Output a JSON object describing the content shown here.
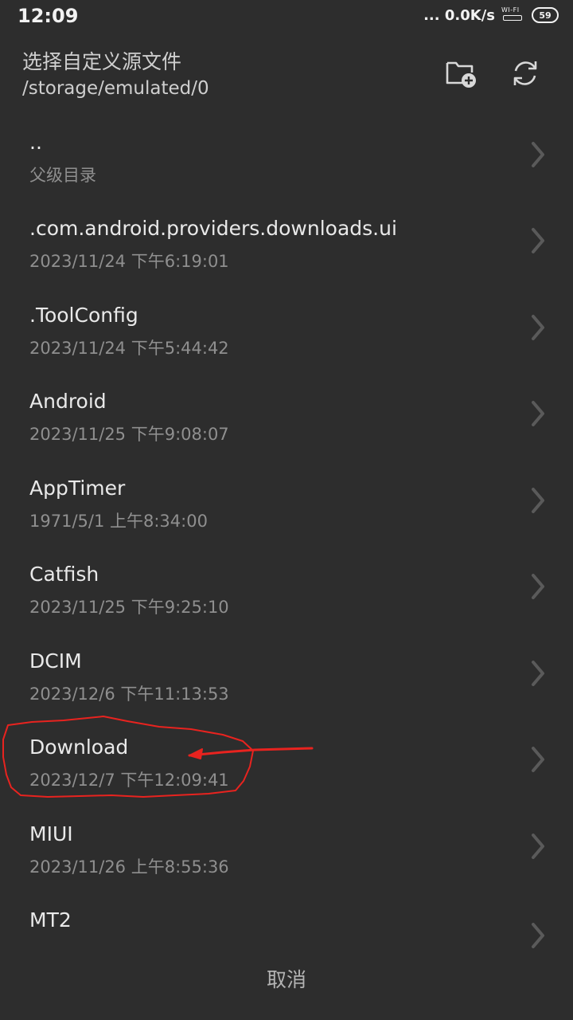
{
  "status_bar": {
    "time": "12:09",
    "speed": "... 0.0K/s",
    "wifi_label": "WI-FI",
    "battery_level": "59"
  },
  "header": {
    "title": "选择自定义源文件",
    "path": "/storage/emulated/0",
    "new_folder_icon": "new-folder-icon",
    "refresh_icon": "refresh-icon"
  },
  "files": [
    {
      "name": "..",
      "sub": "父级目录"
    },
    {
      "name": ".com.android.providers.downloads.ui",
      "sub": "2023/11/24 下午6:19:01"
    },
    {
      "name": ".ToolConfig",
      "sub": "2023/11/24 下午5:44:42"
    },
    {
      "name": "Android",
      "sub": "2023/11/25 下午9:08:07"
    },
    {
      "name": "AppTimer",
      "sub": "1971/5/1 上午8:34:00"
    },
    {
      "name": "Catfish",
      "sub": "2023/11/25 下午9:25:10"
    },
    {
      "name": "DCIM",
      "sub": "2023/12/6 下午11:13:53"
    },
    {
      "name": "Download",
      "sub": "2023/12/7 下午12:09:41"
    },
    {
      "name": "MIUI",
      "sub": "2023/11/26 上午8:55:36"
    },
    {
      "name": "MT2",
      "sub": ""
    }
  ],
  "footer": {
    "cancel_label": "取消"
  },
  "colors": {
    "background": "#2d2d2d",
    "annotation": "#e8231f"
  }
}
